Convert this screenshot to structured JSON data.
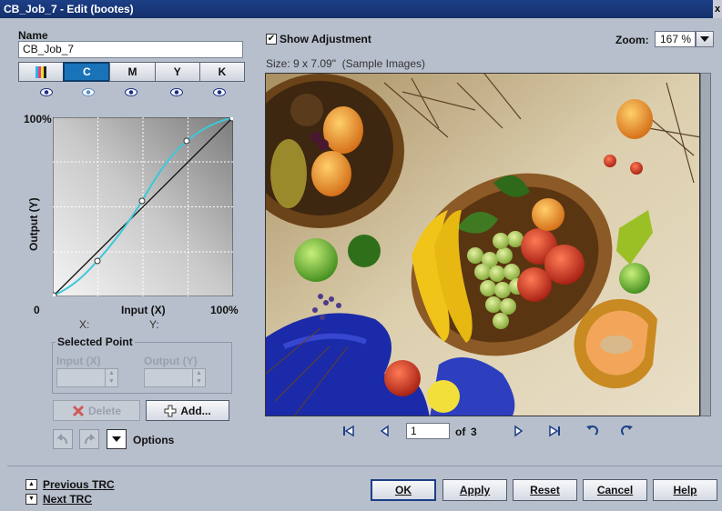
{
  "window": {
    "title": "CB_Job_7 - Edit (bootes)",
    "close_glyph": "x"
  },
  "left": {
    "name_label": "Name",
    "name_value": "CB_Job_7",
    "channels": [
      {
        "label": "",
        "icon": "color-swatch-icon"
      },
      {
        "label": "C"
      },
      {
        "label": "M"
      },
      {
        "label": "Y"
      },
      {
        "label": "K"
      }
    ],
    "graph": {
      "y_max": "100%",
      "y_label": "Output (Y)",
      "x_min": "0",
      "x_label": "Input (X)",
      "x_max": "100%",
      "x_readout": "X:",
      "y_readout": "Y:"
    },
    "selected_point": {
      "title": "Selected Point",
      "input_label": "Input (X)",
      "output_label": "Output (Y)"
    },
    "buttons": {
      "delete": "Delete",
      "add": "Add...",
      "options": "Options"
    }
  },
  "right": {
    "show_adjustment": "Show Adjustment",
    "show_adjustment_checked": true,
    "zoom_label": "Zoom:",
    "zoom_value": "167 %",
    "size_info": "Size: 9 x 7.09\"  (Sample Images)",
    "page_current": "1",
    "page_of": "of",
    "page_total": "3"
  },
  "footer": {
    "previous_trc": "Previous TRC",
    "next_trc": "Next TRC",
    "ok": "OK",
    "apply": "Apply",
    "reset": "Reset",
    "cancel": "Cancel",
    "help": "Help"
  },
  "colors": {
    "accent": "#1a73b8",
    "titlebar": "#1d3f86",
    "curve": "#3cc8d8"
  }
}
